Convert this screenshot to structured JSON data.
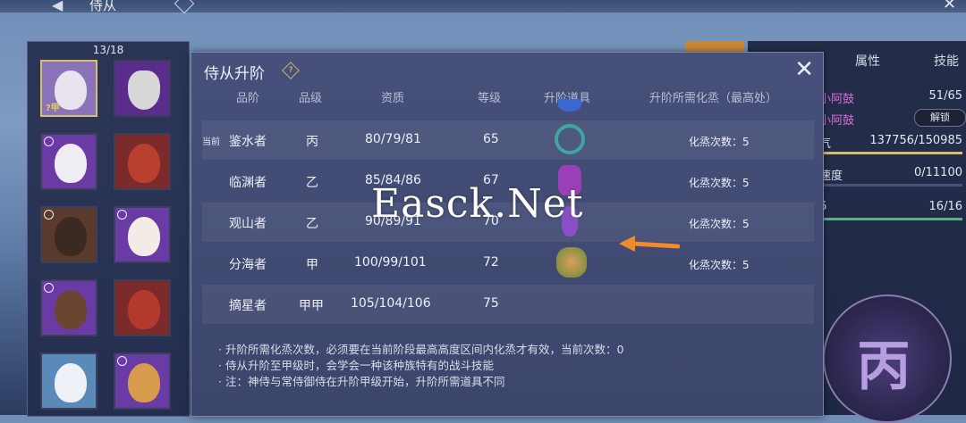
{
  "topbar": {
    "title": "侍从"
  },
  "roster": {
    "count": "13/18",
    "cards": [
      {
        "star": "?甲"
      },
      {
        "star": ""
      },
      {
        "star": ""
      },
      {
        "star": ""
      },
      {
        "star": ""
      },
      {
        "star": ""
      },
      {
        "star": ""
      },
      {
        "star": ""
      },
      {
        "star": ""
      },
      {
        "star": ""
      }
    ]
  },
  "right_panel": {
    "tabs": [
      "属性",
      "技能"
    ],
    "rows": [
      {
        "label": "小阿鼓",
        "value": "51/65"
      },
      {
        "label": "小阿鼓",
        "value": ""
      },
      {
        "label": "气",
        "value": "137756/150985"
      },
      {
        "label": "速度",
        "value": "0/11100"
      },
      {
        "label": "6",
        "value": "16/16"
      }
    ],
    "unlock_button": "解锁",
    "emblem_char": "丙"
  },
  "modal": {
    "title": "侍从升阶",
    "help_icon": "?",
    "close_icon": "✕",
    "headers": [
      "品阶",
      "品级",
      "资质",
      "等级",
      "升阶道具",
      "升阶所需化烝（最高处）"
    ],
    "current_tag": "当前",
    "rows": [
      {
        "rank": "鉴水者",
        "grade": "丙",
        "aptitude": "80/79/81",
        "level": "65",
        "item_color": "#3fa5a0",
        "req": "化烝次数：5"
      },
      {
        "rank": "临渊者",
        "grade": "乙",
        "aptitude": "85/84/86",
        "level": "67",
        "item_color": "#9a3fb8",
        "req": "化烝次数：5"
      },
      {
        "rank": "观山者",
        "grade": "乙",
        "aptitude": "90/89/91",
        "level": "70",
        "item_color": "#8a4fc6",
        "req": "化烝次数：5"
      },
      {
        "rank": "分海者",
        "grade": "甲",
        "aptitude": "100/99/101",
        "level": "72",
        "item_color": "#b06a3a",
        "req": "化烝次数：5"
      },
      {
        "rank": "摘星者",
        "grade": "甲甲",
        "aptitude": "105/104/106",
        "level": "75",
        "item_color": "",
        "req": ""
      }
    ],
    "notes": [
      "· 升阶所需化烝次数，必须要在当前阶段最高高度区间内化烝才有效，当前次数：0",
      "· 侍从升阶至甲级时，会学会一种该种族特有的战斗技能",
      "· 注：神侍与常侍御侍在升阶甲级开始，升阶所需道具不同"
    ]
  },
  "watermark": "Easck.Net",
  "colors": {
    "accent_gold": "#d8c16a",
    "arrow_orange": "#f08a2a",
    "panel_bg": "#3c456b"
  }
}
